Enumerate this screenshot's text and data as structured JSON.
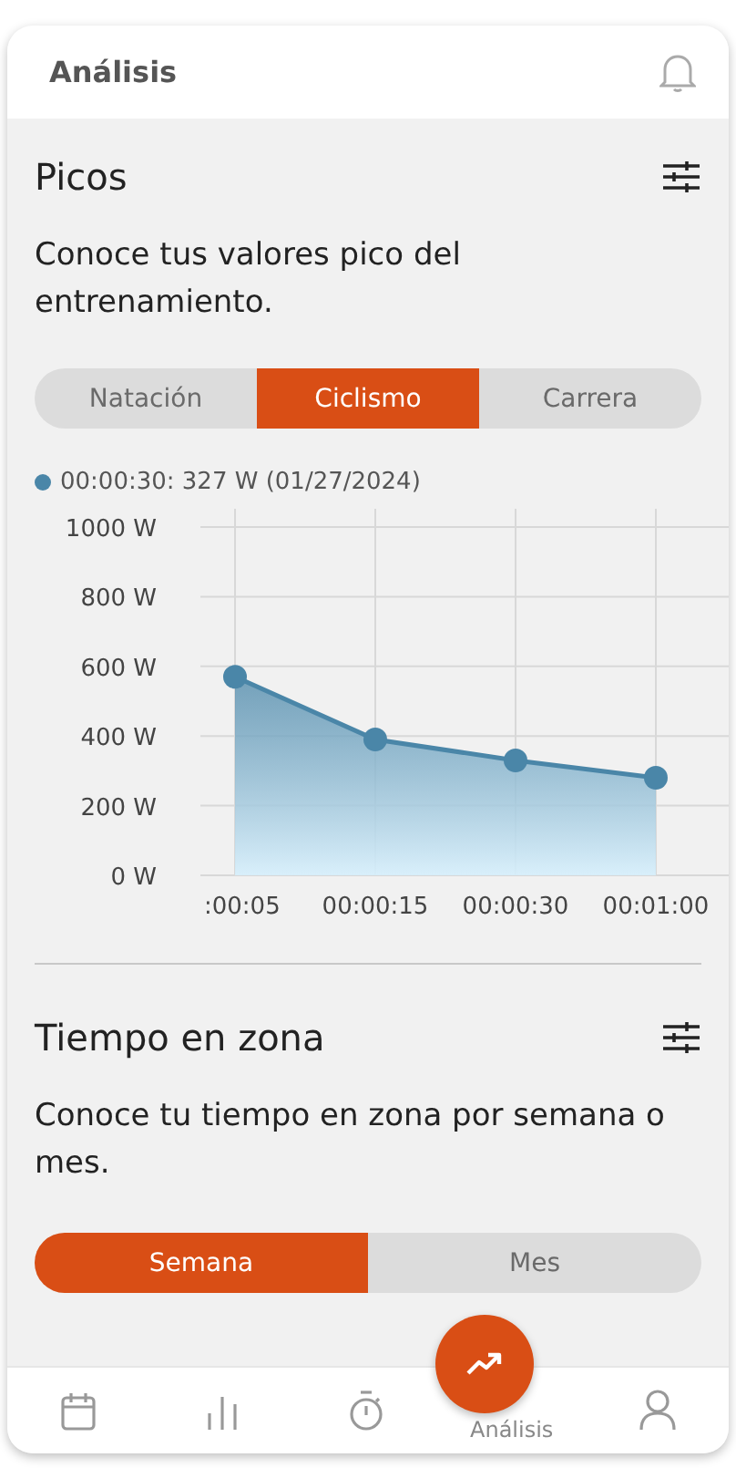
{
  "header": {
    "title": "Análisis"
  },
  "peaks": {
    "title": "Picos",
    "description": "Conoce tus valores pico del entrenamiento.",
    "tabs": [
      {
        "label": "Natación",
        "selected": false
      },
      {
        "label": "Ciclismo",
        "selected": true
      },
      {
        "label": "Carrera",
        "selected": false
      }
    ],
    "legend": {
      "text": "00:00:30: 327 W (01/27/2024)",
      "color": "#4a86a8"
    },
    "chart_data": {
      "type": "area",
      "categories": [
        ":00:05",
        "00:00:15",
        "00:00:30",
        "00:01:00"
      ],
      "series": [
        {
          "color": "#4a86a8",
          "values": [
            570,
            390,
            330,
            280
          ]
        }
      ],
      "grid": true,
      "ylim": [
        0,
        1000
      ],
      "yticks": [
        {
          "value": 0,
          "label": "0 W"
        },
        {
          "value": 200,
          "label": "200 W"
        },
        {
          "value": 400,
          "label": "400 W"
        },
        {
          "value": 600,
          "label": "600 W"
        },
        {
          "value": 800,
          "label": "800 W"
        },
        {
          "value": 1000,
          "label": "1000 W"
        }
      ]
    }
  },
  "zone": {
    "title": "Tiempo en zona",
    "description": "Conoce tu tiempo en zona por semana o mes.",
    "tabs": [
      {
        "label": "Semana",
        "selected": true
      },
      {
        "label": "Mes",
        "selected": false
      }
    ]
  },
  "nav": [
    {
      "kind": "calendar",
      "selected": false
    },
    {
      "kind": "bars",
      "selected": false
    },
    {
      "kind": "stopwatch",
      "selected": false
    },
    {
      "kind": "trend",
      "label": "Análisis",
      "selected": true
    },
    {
      "kind": "person",
      "selected": false
    }
  ]
}
